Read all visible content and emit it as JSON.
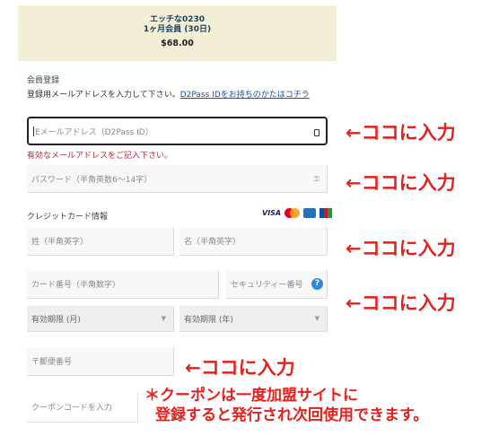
{
  "summary": {
    "product_name": "エッチな0230",
    "membership": "1ヶ月会員 (30日)",
    "price": "$68.00"
  },
  "registration": {
    "section_title": "会員登録",
    "instruction": "登録用メールアドレスを入力して下さい。",
    "d2pass_link": "D2Pass IDをお持ちのかたはコチラ",
    "email_placeholder": "Eメールアドレス（D2Pass ID）",
    "email_error": "有効なメールアドレスをご記入下さい。",
    "password_placeholder": "パスワード（半角英数6～14字）"
  },
  "credit_card": {
    "section_title": "クレジットカード情報",
    "brand_visa": "VISA",
    "last_name_placeholder": "姓（半角英字）",
    "first_name_placeholder": "名（半角英字）",
    "card_number_placeholder": "カード番号（半角数字）",
    "security_code_placeholder": "セキュリティー番号",
    "security_help": "?",
    "expiry_month": "有効期限 (月)",
    "expiry_year": "有効期限 (年)",
    "postal_placeholder": "〒郵便番号",
    "coupon_placeholder": "クーポンコードを入力"
  },
  "annotations": {
    "arrow_text": "←ココに入力",
    "coupon_note_line1": "＊クーポンは一度加盟サイトに",
    "coupon_note_line2": "登録すると発行され次回使用できます。"
  },
  "colors": {
    "summary_bg": "#f3efd6",
    "annotation_red": "#e8201c",
    "error_red": "#c0223a",
    "link_blue": "#1a50a8"
  }
}
